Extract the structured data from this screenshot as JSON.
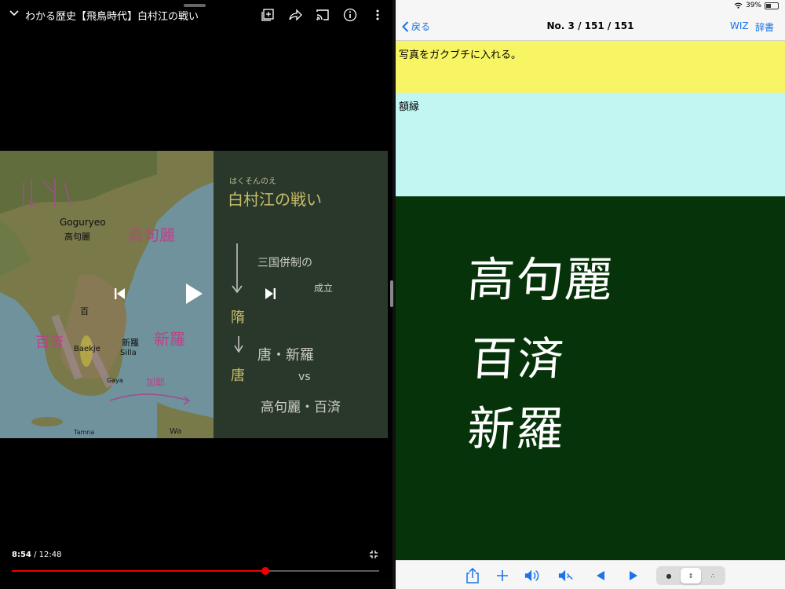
{
  "video": {
    "title": "わかる歴史【飛鳥時代】白村江の戦い",
    "current_time": "8:54",
    "duration": "/ 12:48",
    "progress_percent": 69,
    "map_labels": {
      "goguryeo_en": "Goguryeo",
      "goguryeo_jp": "高句麗",
      "baekje_en": "Baekje",
      "baekje_jp": "百",
      "silla_en": "Silla",
      "silla_jp": "新羅",
      "gaya": "Gaya",
      "tamna": "Tamna",
      "wa": "Wa"
    },
    "map_annotations": {
      "goguryeo": "高句麗",
      "baekje": "百済",
      "silla": "新羅",
      "kaya": "加耶"
    },
    "board": {
      "ruby": "はくそんのえ",
      "heading": "白村江の戦い",
      "line1": "三国併制の",
      "line1b": "成立",
      "sui": "隋",
      "tang": "唐",
      "line2": "唐・新羅",
      "vs": "vs",
      "line3": "高句麗・百済"
    }
  },
  "app": {
    "back_label": "戻る",
    "counter": "No. 3 / 151 / 151",
    "wiz_label": "WIZ",
    "dict_label": "辞書",
    "battery": "39%",
    "question": "写真をガクブチに入れる。",
    "answer": "額縁",
    "handwriting": [
      "高句麗",
      "百済",
      "新羅"
    ]
  },
  "colors": {
    "accent": "#1a73e8",
    "question_bg": "#f7f563",
    "answer_bg": "#c2f6f2",
    "board_bg": "#063309",
    "progress": "#ee0000"
  }
}
